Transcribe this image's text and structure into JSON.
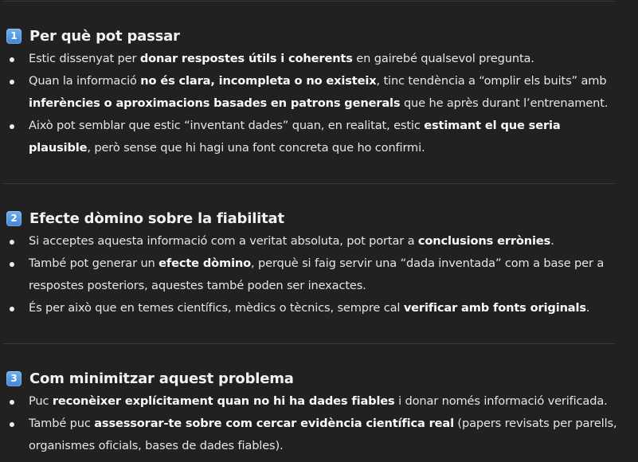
{
  "sections": [
    {
      "number": "1",
      "title": "Per què pot passar",
      "bullets": [
        [
          {
            "t": "Estic dissenyat per "
          },
          {
            "t": "donar respostes útils i coherents",
            "b": true
          },
          {
            "t": " en gairebé qualsevol pregunta."
          }
        ],
        [
          {
            "t": "Quan la informació "
          },
          {
            "t": "no és clara, incompleta o no existeix",
            "b": true
          },
          {
            "t": ", tinc tendència a “omplir els buits” amb "
          },
          {
            "t": "inferències o aproximacions basades en patrons generals",
            "b": true
          },
          {
            "t": " que he après durant l’entrenament."
          }
        ],
        [
          {
            "t": "Això pot semblar que estic “inventant dades” quan, en realitat, estic "
          },
          {
            "t": "estimant el que seria plausible",
            "b": true
          },
          {
            "t": ", però sense que hi hagi una font concreta que ho confirmi."
          }
        ]
      ]
    },
    {
      "number": "2",
      "title": "Efecte dòmino sobre la fiabilitat",
      "bullets": [
        [
          {
            "t": "Si acceptes aquesta informació com a veritat absoluta, pot portar a "
          },
          {
            "t": "conclusions errònies",
            "b": true
          },
          {
            "t": "."
          }
        ],
        [
          {
            "t": "També pot generar un "
          },
          {
            "t": "efecte dòmino",
            "b": true
          },
          {
            "t": ", perquè si faig servir una “dada inventada” com a base per a respostes posteriors, aquestes també poden ser inexactes."
          }
        ],
        [
          {
            "t": "És per això que en temes científics, mèdics o tècnics, sempre cal "
          },
          {
            "t": "verificar amb fonts originals",
            "b": true
          },
          {
            "t": "."
          }
        ]
      ]
    },
    {
      "number": "3",
      "title": "Com minimitzar aquest problema",
      "bullets": [
        [
          {
            "t": "Puc "
          },
          {
            "t": "reconèixer explícitament quan no hi ha dades fiables",
            "b": true
          },
          {
            "t": " i donar només informació verificada."
          }
        ],
        [
          {
            "t": "També puc "
          },
          {
            "t": "assessorar-te sobre com cercar evidència científica real",
            "b": true
          },
          {
            "t": " (papers revisats per parells, organismes oficials, bases de dades fiables)."
          }
        ]
      ]
    }
  ]
}
